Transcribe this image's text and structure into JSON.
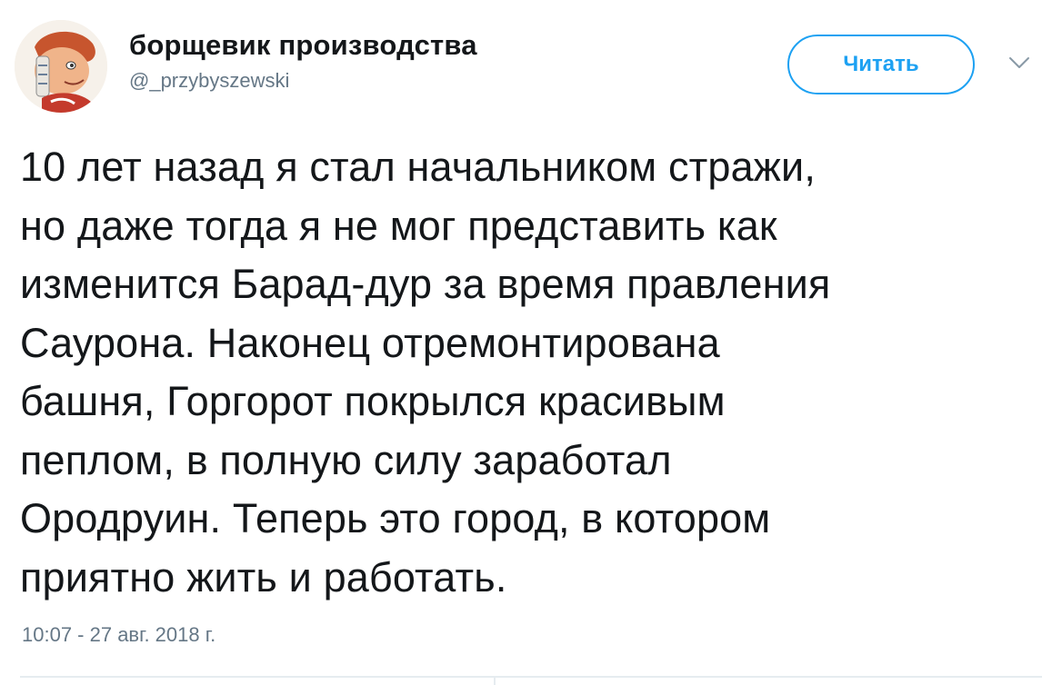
{
  "author": {
    "display_name": "борщевик производства",
    "handle": "@_przybyszewski",
    "avatar_icon": "cartoon-face-avatar"
  },
  "follow_button": {
    "label": "Читать"
  },
  "menu": {
    "caret_icon": "chevron-down-icon"
  },
  "tweet": {
    "text": "10 лет назад я стал начальником стражи,\nно даже тогда я не мог представить как\nизменится Барад-дур за время правления\nСаурона. Наконец отремонтирована\nбашня, Горгорот покрылся красивым\nпеплом, в полную силу заработал\nОродруин. Теперь это город, в котором\nприятно жить и работать.",
    "timestamp": "10:07 - 27 авг. 2018 г."
  },
  "colors": {
    "accent": "#1da1f2",
    "text_primary": "#14171a",
    "text_secondary": "#657786",
    "divider": "#e6ecf0"
  }
}
